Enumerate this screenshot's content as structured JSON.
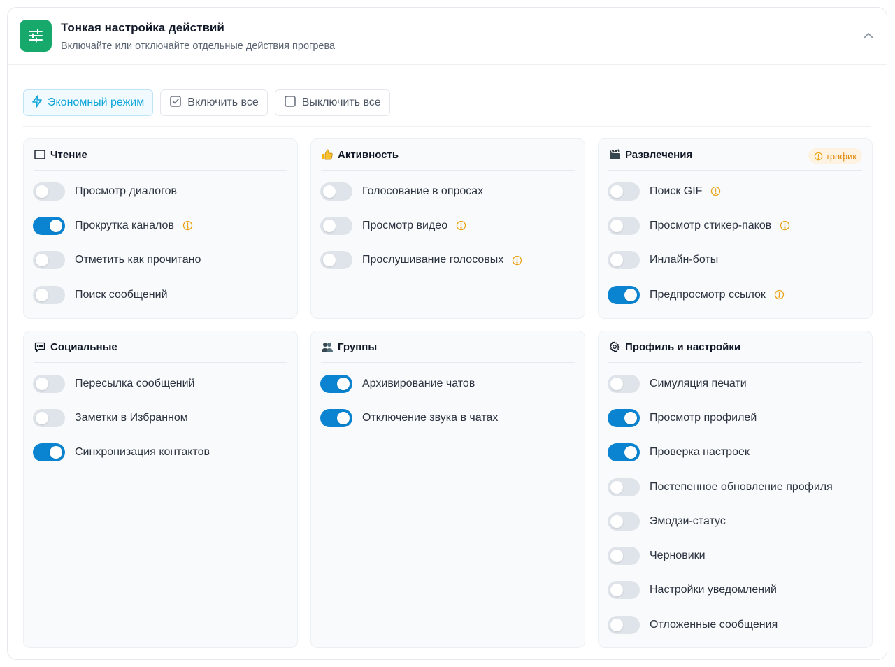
{
  "header": {
    "title": "Тонкая настройка действий",
    "subtitle": "Включайте или отключайте отдельные действия прогрева"
  },
  "toolbar": {
    "economy_label": "Экономный режим",
    "enable_all_label": "Включить все",
    "disable_all_label": "Выключить все"
  },
  "colors": {
    "accent": "#0a84d0",
    "brand_green": "#16a96b",
    "warning": "#e8a317"
  },
  "groups": [
    {
      "title": "Чтение",
      "icon": "book-icon",
      "badge": "",
      "items": [
        {
          "label": "Просмотр диалогов",
          "on": false,
          "warn": false
        },
        {
          "label": "Прокрутка каналов",
          "on": true,
          "warn": true
        },
        {
          "label": "Отметить как прочитано",
          "on": false,
          "warn": false
        },
        {
          "label": "Поиск сообщений",
          "on": false,
          "warn": false
        }
      ]
    },
    {
      "title": "Активность",
      "icon": "thumbs-up-icon",
      "badge": "",
      "items": [
        {
          "label": "Голосование в опросах",
          "on": false,
          "warn": false
        },
        {
          "label": "Просмотр видео",
          "on": false,
          "warn": true
        },
        {
          "label": "Прослушивание голосовых",
          "on": false,
          "warn": true
        }
      ]
    },
    {
      "title": "Развлечения",
      "icon": "clapperboard-icon",
      "badge": "трафик",
      "items": [
        {
          "label": "Поиск GIF",
          "on": false,
          "warn": true
        },
        {
          "label": "Просмотр стикер-паков",
          "on": false,
          "warn": true
        },
        {
          "label": "Инлайн-боты",
          "on": false,
          "warn": false
        },
        {
          "label": "Предпросмотр ссылок",
          "on": true,
          "warn": true
        }
      ]
    },
    {
      "title": "Социальные",
      "icon": "chat-bubble-icon",
      "badge": "",
      "items": [
        {
          "label": "Пересылка сообщений",
          "on": false,
          "warn": false
        },
        {
          "label": "Заметки в Избранном",
          "on": false,
          "warn": false
        },
        {
          "label": "Синхронизация контактов",
          "on": true,
          "warn": false
        }
      ]
    },
    {
      "title": "Группы",
      "icon": "people-icon",
      "badge": "",
      "items": [
        {
          "label": "Архивирование чатов",
          "on": true,
          "warn": false
        },
        {
          "label": "Отключение звука в чатах",
          "on": true,
          "warn": false
        }
      ]
    },
    {
      "title": "Профиль и настройки",
      "icon": "gear-icon",
      "badge": "",
      "items": [
        {
          "label": "Симуляция печати",
          "on": false,
          "warn": false
        },
        {
          "label": "Просмотр профилей",
          "on": true,
          "warn": false
        },
        {
          "label": "Проверка настроек",
          "on": true,
          "warn": false
        },
        {
          "label": "Постепенное обновление профиля",
          "on": false,
          "warn": false
        },
        {
          "label": "Эмодзи-статус",
          "on": false,
          "warn": false
        },
        {
          "label": "Черновики",
          "on": false,
          "warn": false
        },
        {
          "label": "Настройки уведомлений",
          "on": false,
          "warn": false
        },
        {
          "label": "Отложенные сообщения",
          "on": false,
          "warn": false
        }
      ]
    }
  ]
}
